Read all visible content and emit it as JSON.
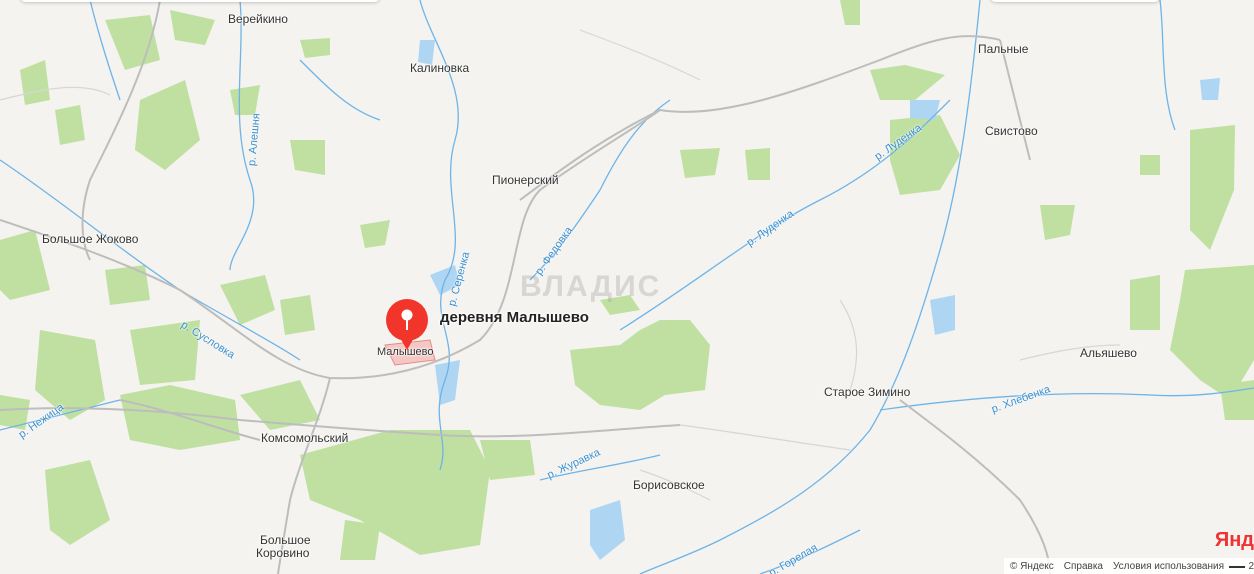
{
  "map": {
    "watermark": "ВЛАДИС",
    "pin_label": "деревня Малышево",
    "places": [
      {
        "id": "vereikino",
        "text": "Верейкино"
      },
      {
        "id": "kalinovka",
        "text": "Калиновка"
      },
      {
        "id": "palnye",
        "text": "Пальные"
      },
      {
        "id": "svistovo",
        "text": "Свистово"
      },
      {
        "id": "pionerskiy",
        "text": "Пионерский"
      },
      {
        "id": "bolshoe-zhokovo",
        "text": "Большое Жоково"
      },
      {
        "id": "malyshevo",
        "text": "Малышево"
      },
      {
        "id": "alyashevo",
        "text": "Альяшево"
      },
      {
        "id": "staroe-zimino",
        "text": "Старое Зимино"
      },
      {
        "id": "komsomolskiy",
        "text": "Комсомольский"
      },
      {
        "id": "borisovskoe",
        "text": "Борисовское"
      },
      {
        "id": "bolshoe-korovino-1",
        "text": "Большое"
      },
      {
        "id": "bolshoe-korovino-2",
        "text": "Коровино"
      }
    ],
    "rivers": [
      {
        "id": "aleshnya",
        "text": "р. Алешня"
      },
      {
        "id": "serenka",
        "text": "р. Серенка"
      },
      {
        "id": "fedovka",
        "text": "р. Федовка"
      },
      {
        "id": "ludenka-1",
        "text": "р. Луденка"
      },
      {
        "id": "ludenka-2",
        "text": "р. Луденка"
      },
      {
        "id": "suslovka",
        "text": "р. Сусловка"
      },
      {
        "id": "nezhitsa",
        "text": "р. Нежица"
      },
      {
        "id": "zhuravka",
        "text": "р. Журавка"
      },
      {
        "id": "khlebenka",
        "text": "р. Хлебенка"
      },
      {
        "id": "gorelaya",
        "text": "р. Горелая"
      }
    ]
  },
  "footer": {
    "copyright": "© Яндекс",
    "help": "Справка",
    "terms": "Условия использования",
    "scale": "2",
    "logo": "Янд"
  },
  "colors": {
    "forest": "#b7dd94",
    "water": "#a8d4f2",
    "river": "#5aa8e6",
    "road": "#c9c9c9",
    "pin": "#f2352b"
  }
}
